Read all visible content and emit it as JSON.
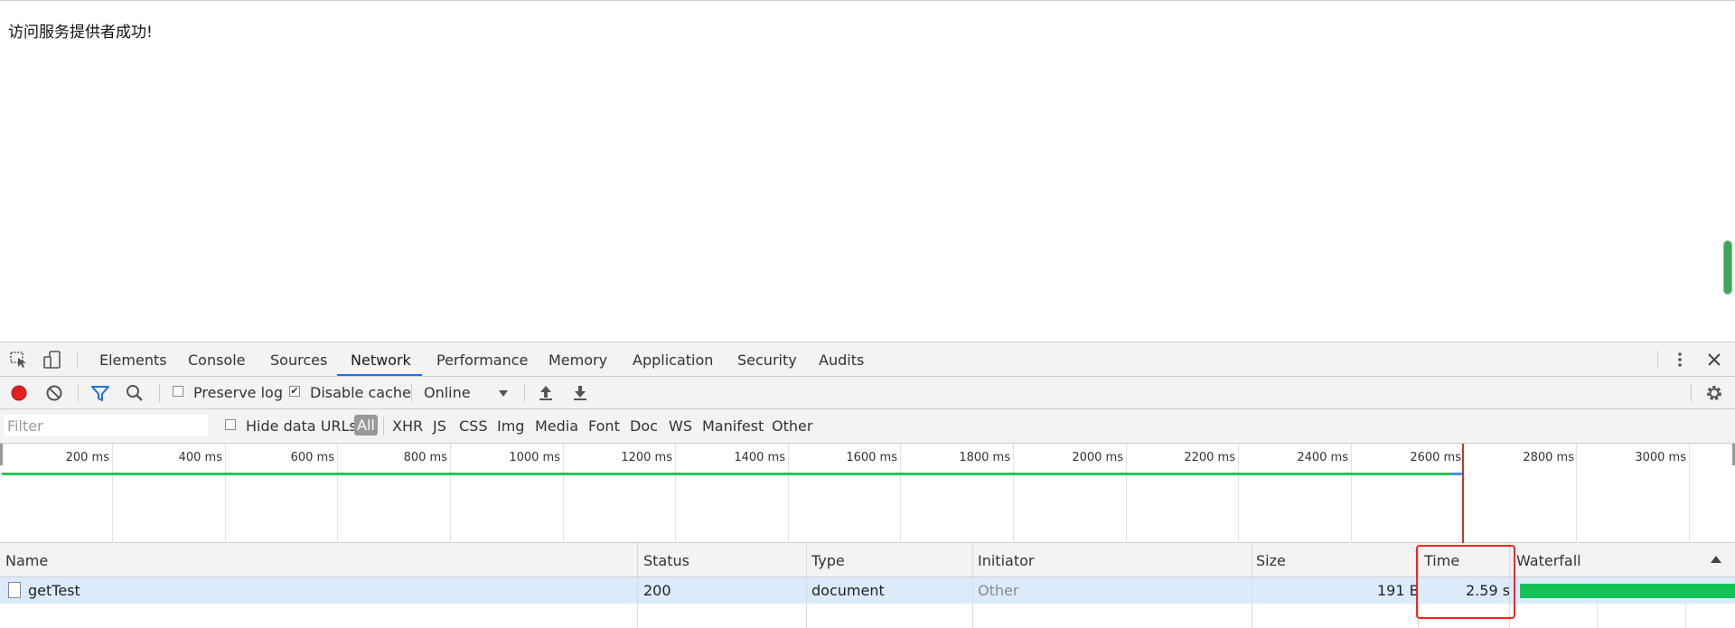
{
  "page": {
    "message": "访问服务提供者成功!"
  },
  "devtools": {
    "tabs": [
      {
        "label": "Elements",
        "active": false
      },
      {
        "label": "Console",
        "active": false
      },
      {
        "label": "Sources",
        "active": false
      },
      {
        "label": "Network",
        "active": true
      },
      {
        "label": "Performance",
        "active": false
      },
      {
        "label": "Memory",
        "active": false
      },
      {
        "label": "Application",
        "active": false
      },
      {
        "label": "Security",
        "active": false
      },
      {
        "label": "Audits",
        "active": false
      }
    ],
    "toolbar": {
      "preserve_log_label": "Preserve log",
      "preserve_log_checked": false,
      "disable_cache_label": "Disable cache",
      "disable_cache_checked": true,
      "throttle_value": "Online"
    },
    "filter": {
      "placeholder": "Filter",
      "hide_data_urls_label": "Hide data URLs",
      "hide_data_urls_checked": false,
      "types": [
        "All",
        "XHR",
        "JS",
        "CSS",
        "Img",
        "Media",
        "Font",
        "Doc",
        "WS",
        "Manifest",
        "Other"
      ],
      "active_type": "All"
    },
    "overview": {
      "tick_labels": [
        "200 ms",
        "400 ms",
        "600 ms",
        "800 ms",
        "1000 ms",
        "1200 ms",
        "1400 ms",
        "1600 ms",
        "1800 ms",
        "2000 ms",
        "2200 ms",
        "2400 ms",
        "2600 ms",
        "2800 ms",
        "3000 ms"
      ]
    },
    "table": {
      "columns": [
        "Name",
        "Status",
        "Type",
        "Initiator",
        "Size",
        "Time",
        "Waterfall"
      ],
      "rows": [
        {
          "name": "getTest",
          "status": "200",
          "type": "document",
          "initiator": "Other",
          "size": "191 B",
          "time": "2.59 s"
        }
      ]
    },
    "colors": {
      "accent": "#1a73e8",
      "record": "#e32121",
      "waterfall_bar": "#16c15a",
      "highlight": "#ff1f1f"
    }
  }
}
